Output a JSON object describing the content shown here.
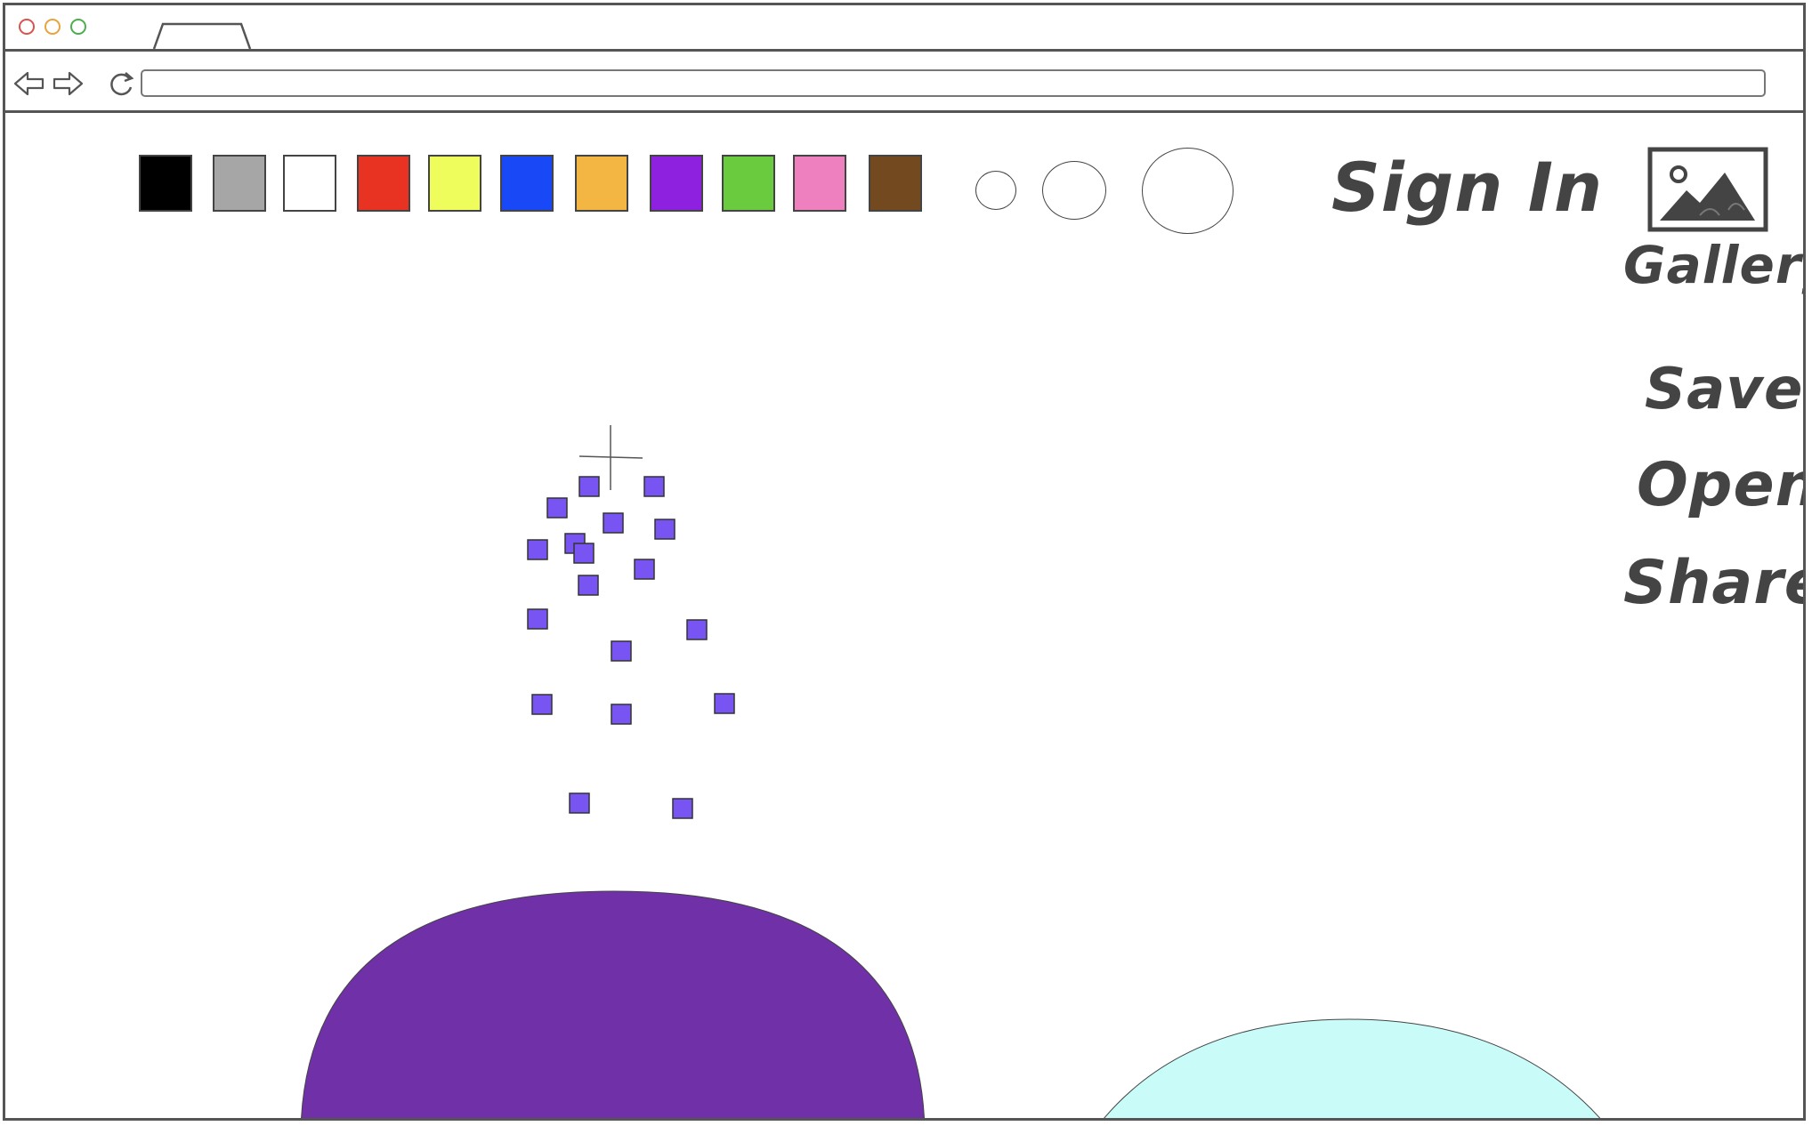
{
  "browser": {
    "window_dots": [
      "#d9534f",
      "#e8a33d",
      "#4cae4c"
    ]
  },
  "toolbar": {
    "colors": [
      "#000000",
      "#a6a6a6",
      "#ffffff",
      "#e83323",
      "#eefd5b",
      "#1949f6",
      "#f4b642",
      "#8e21e0",
      "#6bcb3f",
      "#ee80c0",
      "#734a1f"
    ],
    "brush_sizes": [
      "small",
      "medium",
      "large"
    ]
  },
  "menu": {
    "sign_in_label": "Sign In",
    "gallery_label": "Gallery",
    "save_label": "Save",
    "open_label": "Open",
    "share_label": "Share"
  },
  "canvas": {
    "spray_color": "#7855f3",
    "shape_colors": [
      "#7030a8",
      "#c9fbf8"
    ]
  }
}
